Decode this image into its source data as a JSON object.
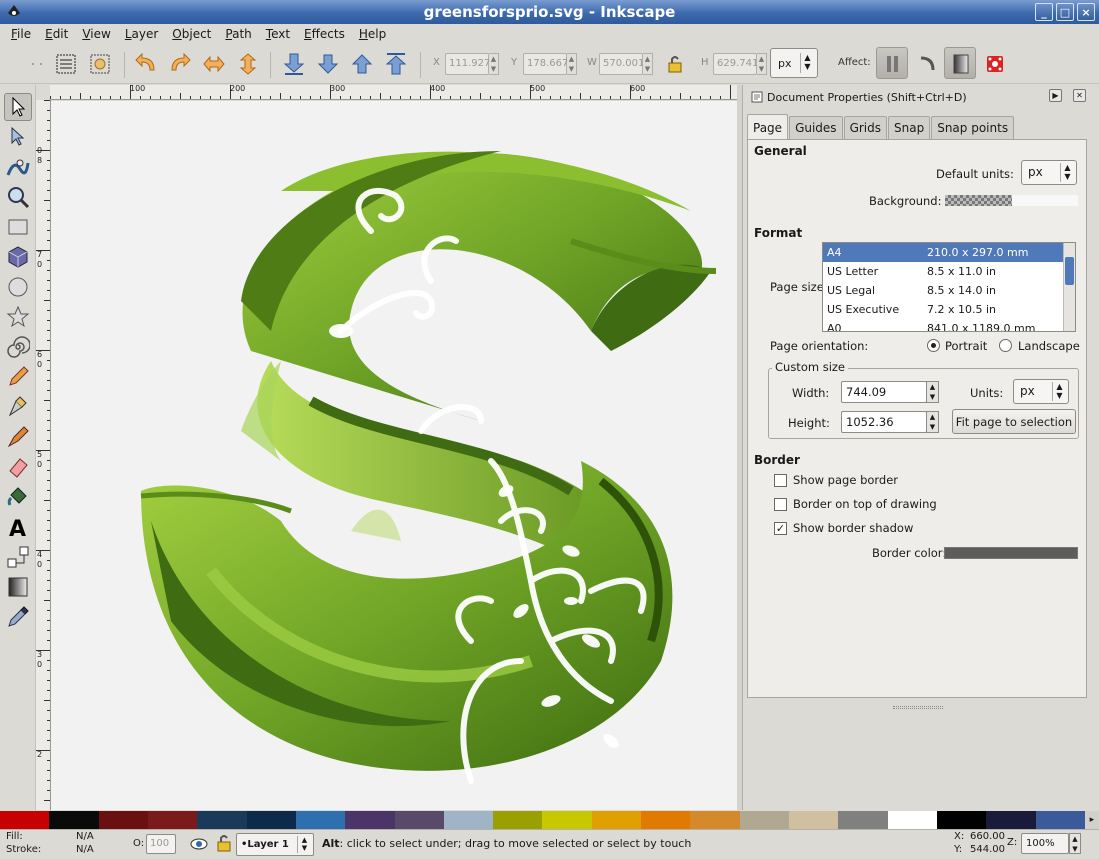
{
  "window": {
    "title": "greensforsprio.svg - Inkscape",
    "buttons": [
      "_",
      "□",
      "×"
    ]
  },
  "menubar": [
    {
      "label": "File",
      "ul": "F",
      "rest": "ile"
    },
    {
      "label": "Edit",
      "ul": "E",
      "rest": "dit"
    },
    {
      "label": "View",
      "ul": "V",
      "rest": "iew"
    },
    {
      "label": "Layer",
      "ul": "L",
      "rest": "ayer"
    },
    {
      "label": "Object",
      "ul": "O",
      "rest": "bject"
    },
    {
      "label": "Path",
      "ul": "P",
      "rest": "ath"
    },
    {
      "label": "Text",
      "ul": "T",
      "rest": "ext"
    },
    {
      "label": "Effects",
      "ul": "E",
      "rest": "ffects"
    },
    {
      "label": "Help",
      "ul": "H",
      "rest": "elp"
    }
  ],
  "toolbar": {
    "x_label": "X",
    "x_value": "111.927",
    "y_label": "Y",
    "y_value": "178.667",
    "w_label": "W",
    "w_value": "570.001",
    "h_label": "H",
    "h_value": "629.741",
    "unit": "px",
    "affect_label": "Affect:"
  },
  "rulers": {
    "h_ticks": [
      "100",
      "200",
      "300",
      "400",
      "500",
      "600"
    ],
    "v_ticks": [
      "0",
      "8",
      "7",
      "0",
      "6",
      "0",
      "5",
      "0",
      "4",
      "0",
      "3",
      "0",
      "2"
    ]
  },
  "dock": {
    "title": "Document Properties (Shift+Ctrl+D)",
    "tabs": [
      "Page",
      "Guides",
      "Grids",
      "Snap",
      "Snap points"
    ],
    "general": {
      "title": "General",
      "default_units_label": "Default units:",
      "default_units_value": "px",
      "background_label": "Background:"
    },
    "format": {
      "title": "Format",
      "page_size_label": "Page size:",
      "sizes": [
        {
          "name": "A4",
          "size": "210.0 x 297.0 mm"
        },
        {
          "name": "US Letter",
          "size": "8.5 x 11.0 in"
        },
        {
          "name": "US Legal",
          "size": "8.5 x 14.0 in"
        },
        {
          "name": "US Executive",
          "size": "7.2 x 10.5 in"
        },
        {
          "name": "A0",
          "size": "841.0 x 1189.0 mm"
        }
      ],
      "orientation_label": "Page orientation:",
      "portrait": "Portrait",
      "landscape": "Landscape",
      "custom_size_label": "Custom size",
      "width_label": "Width:",
      "width_value": "744.09",
      "height_label": "Height:",
      "height_value": "1052.36",
      "units_label": "Units:",
      "units_value": "px",
      "fit_button": "Fit page to selection"
    },
    "border": {
      "title": "Border",
      "show_border": "Show page border",
      "border_on_top": "Border on top of drawing",
      "show_shadow": "Show border shadow",
      "border_color_label": "Border color:",
      "border_color": "#5e5c5a"
    }
  },
  "palette": [
    "#c80000",
    "#0a0a0a",
    "#6a1010",
    "#7a1a1a",
    "#1b3a5a",
    "#0e2a4a",
    "#2e6fb0",
    "#4a3468",
    "#5a4a6a",
    "#a0b4c8",
    "#9aa000",
    "#c8c800",
    "#e0a000",
    "#e07a00",
    "#d48a2a",
    "#b0a890",
    "#d0c0a0",
    "#808080",
    "#ffffff",
    "#000000",
    "#1a1a3a",
    "#3a5a9a"
  ],
  "status": {
    "fill_label": "Fill:",
    "fill_value": "N/A",
    "stroke_label": "Stroke:",
    "stroke_value": "N/A",
    "opacity_label": "O:",
    "opacity_value": "100",
    "layer": "•Layer 1",
    "message_bold": "Alt",
    "message": ": click to select under; drag to move selected or select by touch",
    "x_label": "X:",
    "x_value": "660.00",
    "y_label": "Y:",
    "y_value": "544.00",
    "z_label": "Z:",
    "zoom": "100%"
  },
  "colors": {
    "titlebar": "#3d6aae",
    "selection": "#4f79b8",
    "leaf_green": "#7ab32e",
    "dark_green": "#3f6b12"
  }
}
